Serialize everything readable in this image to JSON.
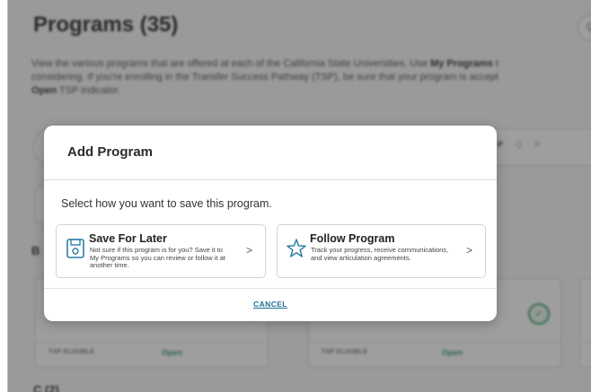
{
  "page": {
    "title": "Programs (35)",
    "intro_line1_a": "View the various programs that are offered at each of the California State Universities. Use ",
    "intro_line1_bold": "My Programs",
    "intro_line1_b": " t",
    "intro_line2": "considering. If you're enrolling in the Transfer Success Pathway (TSP), be sure that your program is accept",
    "intro_line3_bold": "Open",
    "intro_line3_rest": " TSP indicator.",
    "letters": [
      "P",
      "Q",
      "R"
    ],
    "section_b": "B",
    "section_c": "C (2)",
    "cards": [
      {
        "tag": "TSP ELIGIBLE",
        "status": "Open"
      },
      {
        "tag": "TSP ELIGIBLE",
        "status": "Open"
      }
    ]
  },
  "modal": {
    "title": "Add Program",
    "prompt": "Select how you want to save this program.",
    "options": [
      {
        "icon": "save-icon",
        "title": "Save For Later",
        "description": "Not sure if this program is for you? Save it to My Programs so you can review or follow it at another time.",
        "chevron": ">"
      },
      {
        "icon": "star-icon",
        "title": "Follow Program",
        "description": "Track your progress, receive communications, and view articulation agreements.",
        "chevron": ">"
      }
    ],
    "cancel_label": "CANCEL"
  },
  "colors": {
    "accent": "#1f6f96",
    "open_green": "#3a9b6b",
    "overlay": "#282828"
  }
}
